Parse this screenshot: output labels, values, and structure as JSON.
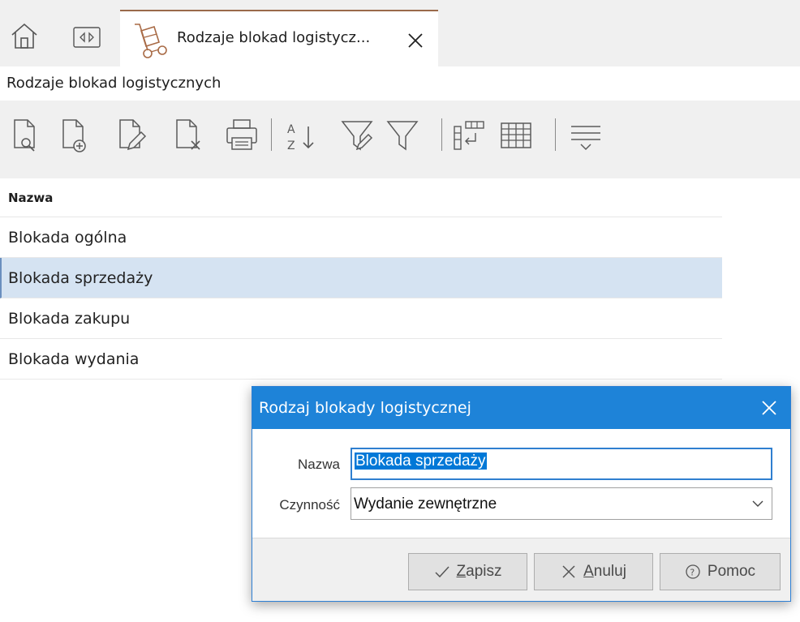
{
  "tabbar": {
    "home_icon": "home-icon",
    "nav_icon": "nav-arrows-icon",
    "active_tab": {
      "label": "Rodzaje blokad logistycz...",
      "icon": "hand-truck-icon",
      "accent": "#9a6a4a"
    }
  },
  "page_title": "Rodzaje blokad logistycznych",
  "toolbar": {
    "tools": [
      {
        "icon": "view-document-icon"
      },
      {
        "icon": "add-document-icon"
      },
      {
        "icon": "edit-document-icon"
      },
      {
        "icon": "delete-document-icon"
      },
      {
        "icon": "print-icon"
      },
      {
        "icon": "sort-az-icon"
      },
      {
        "icon": "filter-edit-icon"
      },
      {
        "icon": "filter-icon"
      },
      {
        "icon": "column-layout-icon"
      },
      {
        "icon": "grid-icon"
      },
      {
        "icon": "options-menu-icon"
      }
    ]
  },
  "grid": {
    "header": "Nazwa",
    "rows": [
      "Blokada ogólna",
      "Blokada sprzedaży",
      "Blokada zakupu",
      "Blokada wydania"
    ],
    "selected_row": "Blokada sprzedaży",
    "selected_color": "#d5e3f2"
  },
  "dialog": {
    "title": "Rodzaj blokady logistycznej",
    "title_color": "#1e83d8",
    "fields": {
      "name_label": "Nazwa",
      "name_value": "Blokada sprzedaży",
      "activity_label": "Czynność",
      "activity_value": "Wydanie zewnętrzne"
    },
    "buttons": {
      "save_access": "Z",
      "save_rest": "apisz",
      "cancel_access": "A",
      "cancel_rest": "nuluj",
      "help": "Pomoc"
    }
  }
}
